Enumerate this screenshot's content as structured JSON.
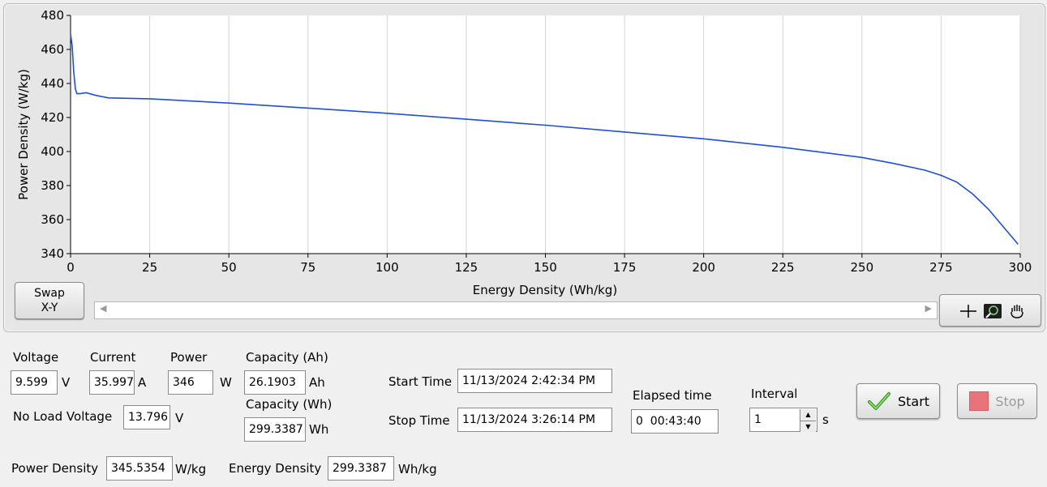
{
  "chart_data": {
    "type": "line",
    "xlabel": "Energy Density (Wh/kg)",
    "ylabel": "Power Density (W/kg)",
    "xlim": [
      0,
      300
    ],
    "ylim": [
      340,
      480
    ],
    "xticks": [
      0,
      25,
      50,
      75,
      100,
      125,
      150,
      175,
      200,
      225,
      250,
      275,
      300
    ],
    "yticks": [
      340,
      360,
      380,
      400,
      420,
      440,
      460,
      480
    ],
    "grid": "vertical",
    "line_color": "#1f4fd8",
    "series": [
      {
        "x": [
          0,
          0.5,
          1,
          1.5,
          2,
          3,
          5,
          8,
          12,
          25,
          50,
          75,
          100,
          125,
          150,
          175,
          200,
          225,
          250,
          260,
          270,
          275,
          280,
          285,
          290,
          295,
          299.3
        ],
        "y": [
          469,
          462,
          447,
          437,
          434,
          434,
          434.5,
          433,
          431.5,
          431,
          428.5,
          425.5,
          422.5,
          419,
          415.5,
          411.5,
          407.5,
          402.5,
          396.5,
          393,
          389,
          386,
          382,
          375,
          366,
          355,
          345.5
        ]
      }
    ]
  },
  "controls": {
    "swap_line1": "Swap",
    "swap_line2": "X-Y",
    "start_label": "Start",
    "stop_label": "Stop",
    "tools": [
      "crosshair-icon",
      "zoom-icon",
      "pan-hand-icon"
    ]
  },
  "fields": {
    "voltage_label": "Voltage",
    "voltage_value": "9.599",
    "voltage_unit": "V",
    "current_label": "Current",
    "current_value": "35.997",
    "current_unit": "A",
    "power_label": "Power",
    "power_value": "346",
    "power_unit": "W",
    "capacity_ah_label": "Capacity (Ah)",
    "capacity_ah_value": "26.1903",
    "capacity_ah_unit": "Ah",
    "capacity_wh_label": "Capacity (Wh)",
    "capacity_wh_value": "299.3387",
    "capacity_wh_unit": "Wh",
    "no_load_label": "No Load Voltage",
    "no_load_value": "13.796",
    "no_load_unit": "V",
    "start_time_label": "Start Time",
    "start_time_value": "11/13/2024 2:42:34 PM",
    "stop_time_label": "Stop Time",
    "stop_time_value": "11/13/2024 3:26:14 PM",
    "elapsed_label": "Elapsed time",
    "elapsed_value": "0  00:43:40",
    "interval_label": "Interval",
    "interval_value": "1",
    "interval_unit": "s",
    "power_density_label": "Power Density",
    "power_density_value": "345.5354",
    "power_density_unit": "W/kg",
    "energy_density_label": "Energy Density",
    "energy_density_value": "299.3387",
    "energy_density_unit": "Wh/kg"
  }
}
